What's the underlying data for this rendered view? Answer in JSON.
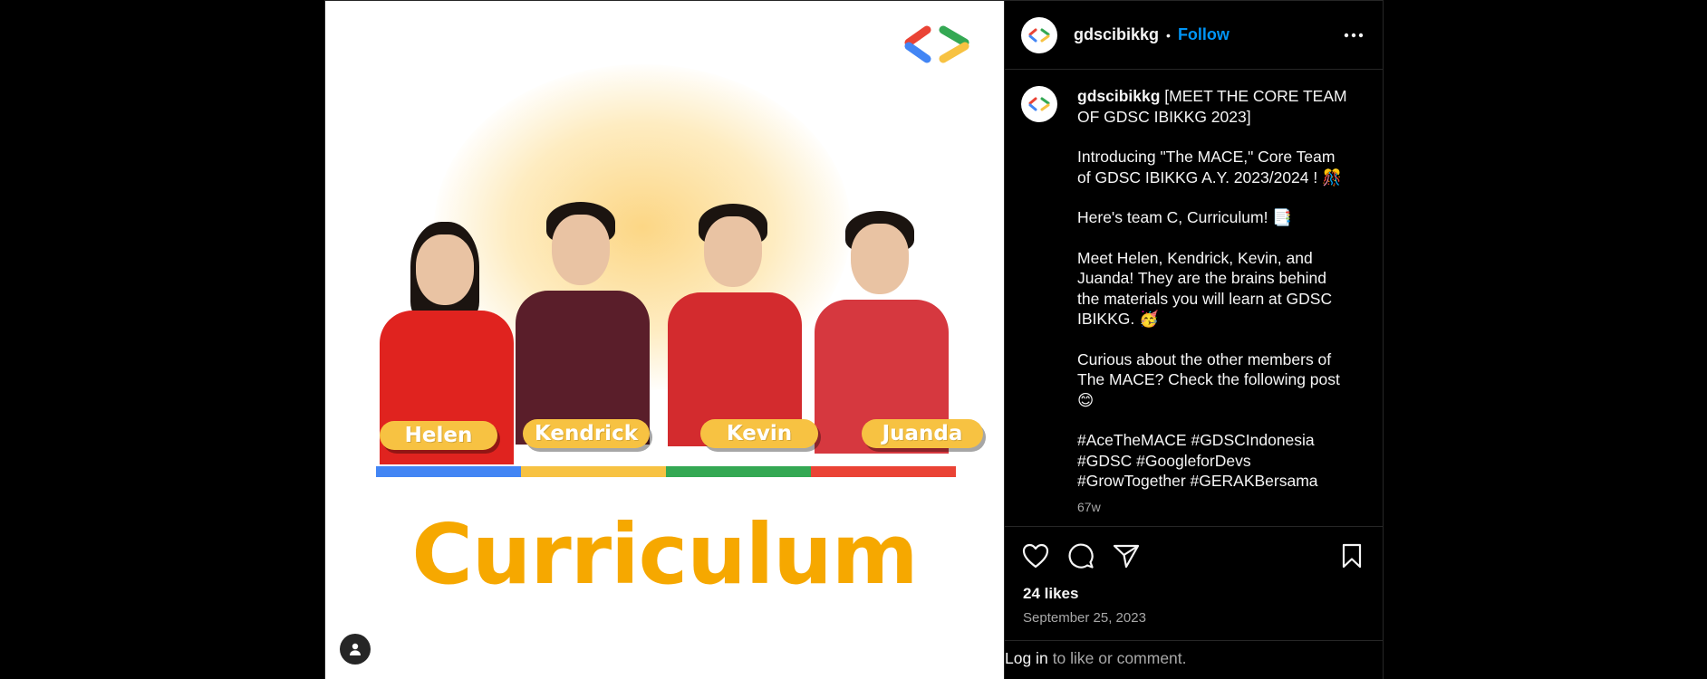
{
  "post": {
    "image": {
      "names": [
        "Helen",
        "Kendrick",
        "Kevin",
        "Juanda"
      ],
      "title": "Curriculum",
      "stripe_colors": [
        "#4285f4",
        "#f7c242",
        "#34a853",
        "#ea4335"
      ],
      "shirt_colors": [
        "#e0231f",
        "#5a1e2a",
        "#d32b2e",
        "#d6383f"
      ]
    },
    "header": {
      "username": "gdscibikkg",
      "separator": "•",
      "follow_label": "Follow"
    },
    "caption": {
      "username": "gdscibikkg",
      "first_line": "[MEET THE CORE TEAM OF GDSC IBIKKG 2023]",
      "paragraphs": [
        "Introducing \"The MACE,\" Core Team of GDSC IBIKKG A.Y. 2023/2024 ! 🎊",
        "Here's team C, Curriculum! 📑",
        "Meet Helen, Kendrick, Kevin, and Juanda! They are the brains behind the materials you will learn at GDSC IBIKKG. 🥳",
        "Curious about the other members of The MACE? Check the following post 😊",
        "#AceTheMACE #GDSCIndonesia #GDSC #GoogleforDevs #GrowTogether #GERAKBersama"
      ],
      "time_ago": "67w"
    },
    "likes": "24 likes",
    "date": "September 25, 2023",
    "login": {
      "link": "Log in",
      "rest": "to like or comment."
    },
    "colors": {
      "follow": "#0095f6",
      "orange_title": "#f6a800"
    }
  }
}
